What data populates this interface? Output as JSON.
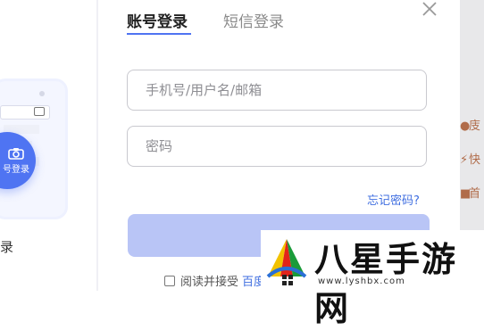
{
  "tabs": {
    "account": "账号登录",
    "sms": "短信登录"
  },
  "form": {
    "account_placeholder": "手机号/用户名/邮箱",
    "password_placeholder": "密码",
    "forgot_label": "忘记密码?",
    "login_label": ""
  },
  "agreement": {
    "prefix": "阅读并接受",
    "link": "百度"
  },
  "left_panel": {
    "scan_label": "号登录",
    "bottom_text": "录"
  },
  "right_panel": {
    "item1": "庋",
    "item2": "快",
    "item3": "首"
  },
  "watermark": {
    "title": "八星手游网",
    "url": "www.lyshbx.com"
  },
  "colors": {
    "accent": "#4f74f2",
    "login_button": "#b9c5f6",
    "link": "#3f6ee0"
  }
}
